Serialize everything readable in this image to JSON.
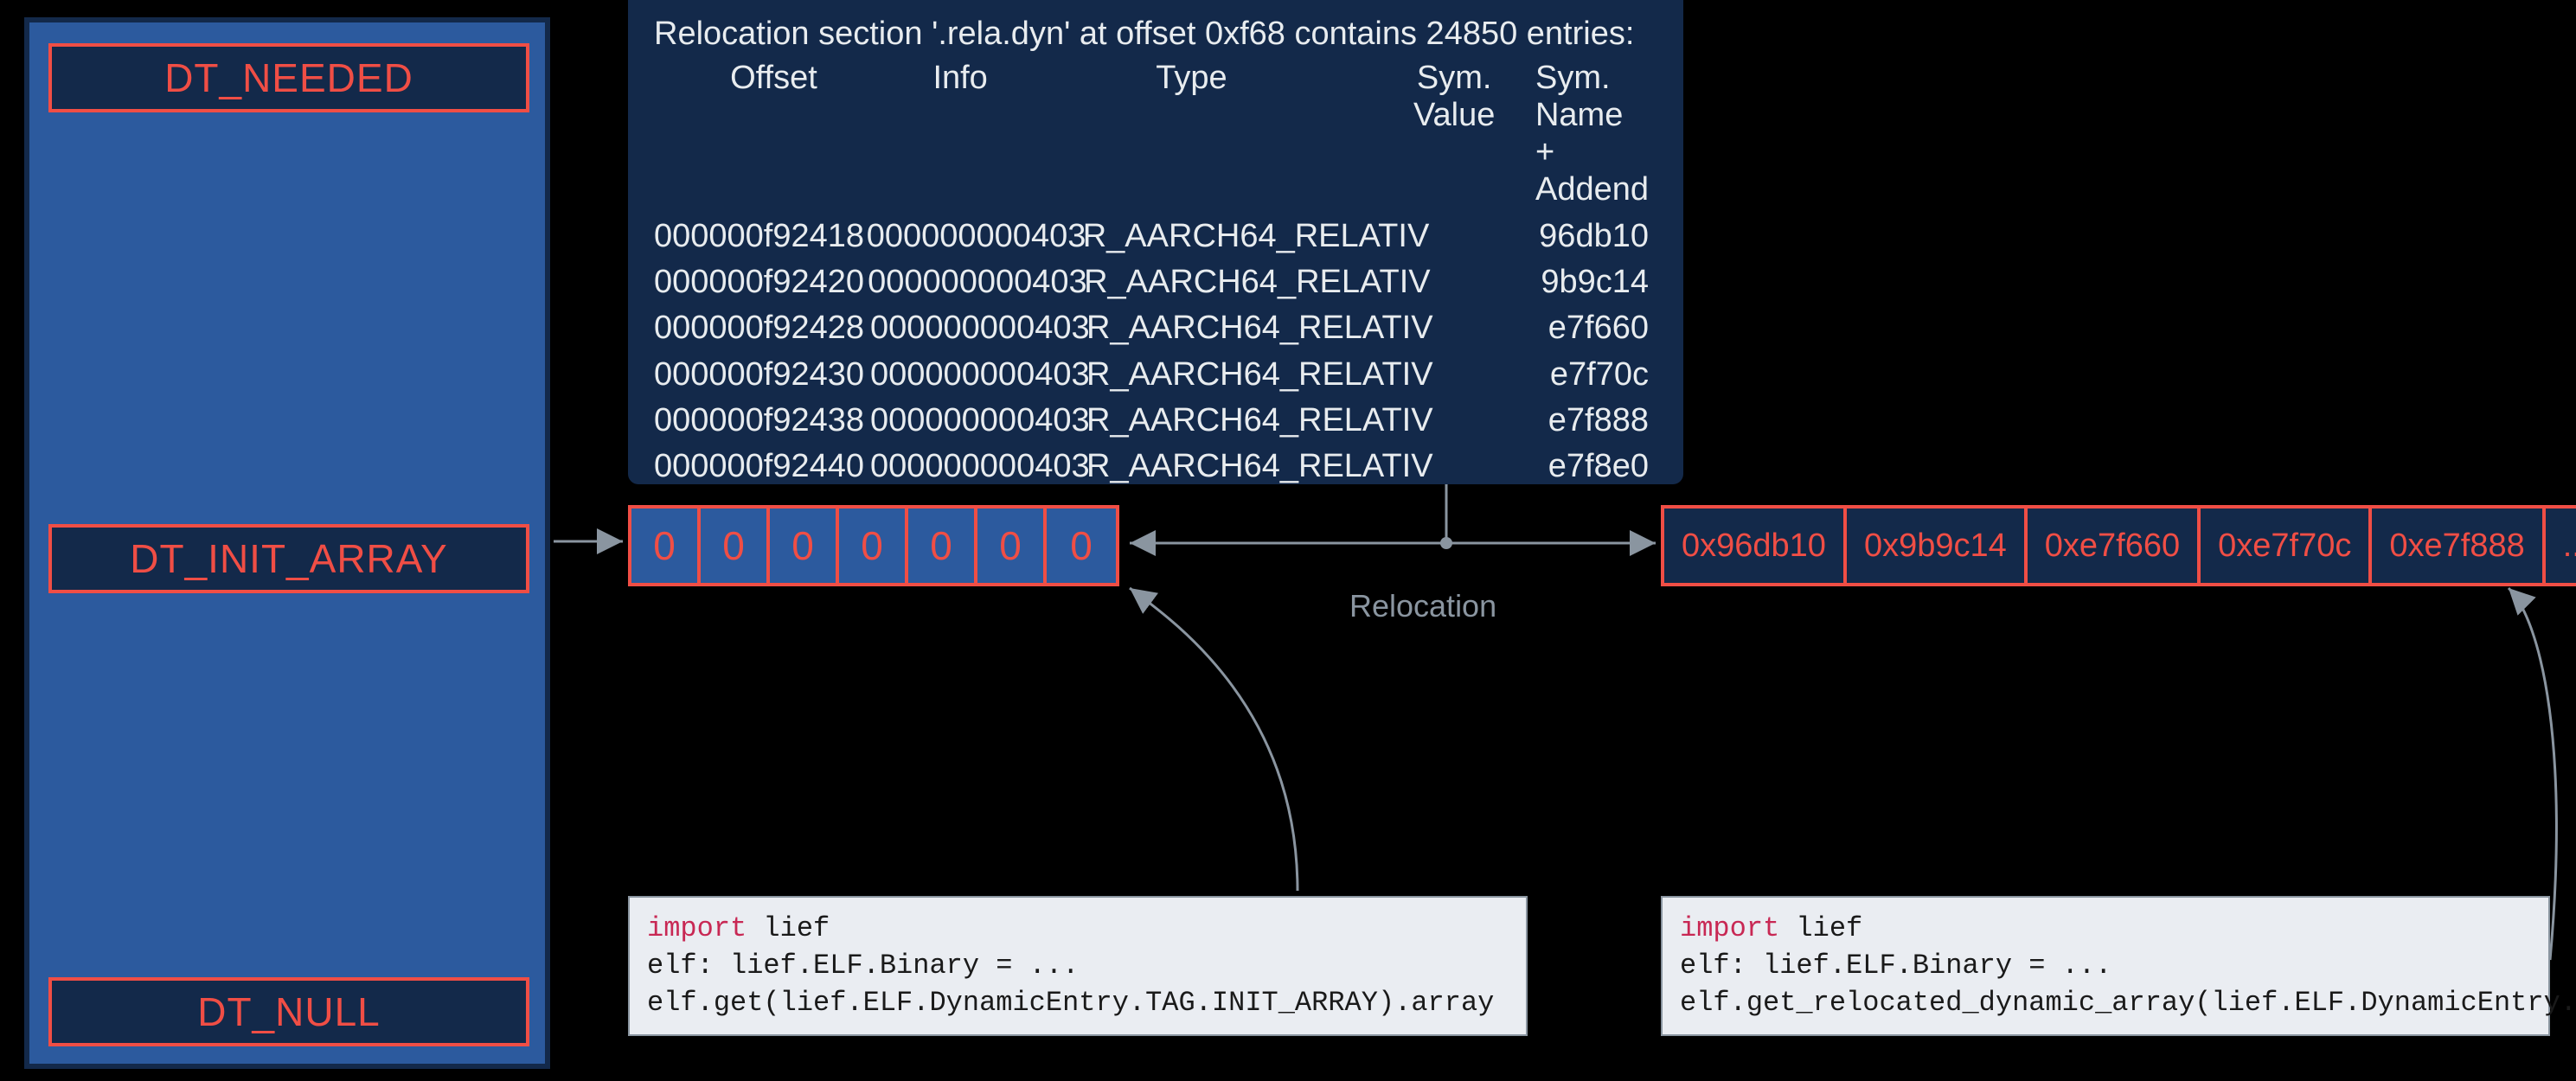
{
  "dyn_entries": {
    "needed": "DT_NEEDED",
    "init_array": "DT_INIT_ARRAY",
    "null": "DT_NULL"
  },
  "reloc": {
    "title": "Relocation section '.rela.dyn' at offset 0xf68 contains 24850 entries:",
    "headers": {
      "offset": "Offset",
      "info": "Info",
      "type": "Type",
      "value": "Sym. Value",
      "name": "Sym. Name + Addend"
    },
    "rows": [
      {
        "offset": "000000f92418",
        "info": "000000000403",
        "type": "R_AARCH64_RELATIV",
        "name": "96db10"
      },
      {
        "offset": "000000f92420",
        "info": "000000000403",
        "type": "R_AARCH64_RELATIV",
        "name": "9b9c14"
      },
      {
        "offset": "000000f92428",
        "info": "000000000403",
        "type": "R_AARCH64_RELATIV",
        "name": "e7f660"
      },
      {
        "offset": "000000f92430",
        "info": "000000000403",
        "type": "R_AARCH64_RELATIV",
        "name": "e7f70c"
      },
      {
        "offset": "000000f92438",
        "info": "000000000403",
        "type": "R_AARCH64_RELATIV",
        "name": "e7f888"
      },
      {
        "offset": "000000f92440",
        "info": "000000000403",
        "type": "R_AARCH64_RELATIV",
        "name": "e7f8e0"
      }
    ]
  },
  "zero_array": [
    "0",
    "0",
    "0",
    "0",
    "0",
    "0",
    "0"
  ],
  "hex_array": [
    "0x96db10",
    "0x9b9c14",
    "0xe7f660",
    "0xe7f70c",
    "0xe7f888",
    "..."
  ],
  "relocation_label": "Relocation",
  "code_left": {
    "l1a": "import",
    "l1b": " lief",
    "l2": "elf: lief.ELF.Binary = ...",
    "l3": "elf.get(lief.ELF.DynamicEntry.TAG.INIT_ARRAY).array"
  },
  "code_right": {
    "l1a": "import",
    "l1b": " lief",
    "l2": "elf: lief.ELF.Binary = ...",
    "l3": "elf.get_relocated_dynamic_array(lief.ELF.DynamicEntry.TAG.INIT_ARRAY)"
  }
}
